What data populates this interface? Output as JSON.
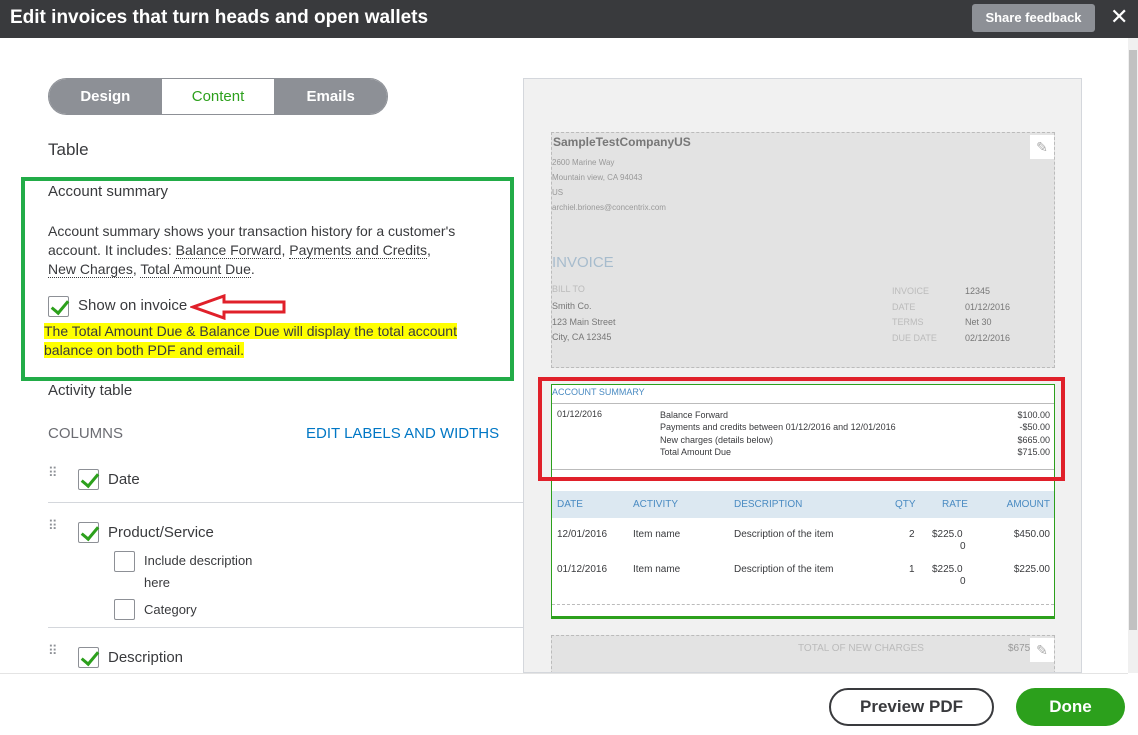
{
  "header": {
    "title": "Edit invoices that turn heads and open wallets",
    "feedback": "Share feedback",
    "close": "✕"
  },
  "tabs": [
    {
      "label": "Design"
    },
    {
      "label": "Content",
      "active": true
    },
    {
      "label": "Emails"
    }
  ],
  "left": {
    "section": "Table",
    "account_summary": {
      "title": "Account summary",
      "desc1": "Account summary shows your transaction history for a customer's",
      "desc2": "account. It includes: ",
      "l1": "Balance Forward",
      "l2": "Payments and Credits",
      "l3": "New Charges",
      "l4": "Total Amount Due",
      "show_label": "Show on invoice",
      "show_checked": true,
      "note1": "The Total Amount Due & Balance Due will display the total account",
      "note2": "balance on both PDF and email."
    },
    "activity": {
      "title": "Activity table",
      "columns": "COLUMNS",
      "edit_link": "EDIT LABELS AND WIDTHS",
      "items": [
        {
          "label": "Date",
          "checked": true
        },
        {
          "label": "Product/Service",
          "checked": true
        },
        {
          "label": "Description",
          "checked": true
        }
      ],
      "sub": [
        {
          "label1": "Include description",
          "label2": "here",
          "checked": false
        },
        {
          "label1": "Category",
          "checked": false
        }
      ]
    }
  },
  "preview": {
    "company": "SampleTestCompanyUS",
    "addr": [
      "2600 Marine Way",
      "Mountain view, CA 94043",
      "US",
      "archiel.briones@concentrix.com"
    ],
    "invoice_title": "INVOICE",
    "bill_to": "BILL TO",
    "bill": [
      "Smith Co.",
      "123 Main Street",
      "City, CA 12345"
    ],
    "meta": [
      [
        "INVOICE",
        "12345"
      ],
      [
        "DATE",
        "01/12/2016"
      ],
      [
        "TERMS",
        "Net 30"
      ],
      [
        "DUE DATE",
        "02/12/2016"
      ]
    ],
    "summary": {
      "title": "ACCOUNT SUMMARY",
      "date": "01/12/2016",
      "rows": [
        [
          "Balance Forward",
          "$100.00"
        ],
        [
          "Payments and credits between 01/12/2016 and 12/01/2016",
          "-$50.00"
        ],
        [
          "New charges (details below)",
          "$665.00"
        ],
        [
          "Total Amount Due",
          "$715.00"
        ]
      ]
    },
    "table": {
      "headers": [
        "DATE",
        "ACTIVITY",
        "DESCRIPTION",
        "QTY",
        "RATE",
        "AMOUNT"
      ],
      "rows": [
        [
          "12/01/2016",
          "Item name",
          "Description of the item",
          "2",
          "$225.0",
          "0",
          "$450.00"
        ],
        [
          "01/12/2016",
          "Item name",
          "Description of the item",
          "1",
          "$225.0",
          "0",
          "$225.00"
        ]
      ]
    },
    "totals_label": "TOTAL OF NEW CHARGES",
    "totals_value": "$675"
  },
  "footer": {
    "preview": "Preview PDF",
    "done": "Done"
  },
  "colors": {
    "accent": "#2ca01c",
    "header": "#393a3d",
    "annotation_red": "#e0202a",
    "annotation_green": "#22ac48",
    "highlight": "#ffff00"
  }
}
